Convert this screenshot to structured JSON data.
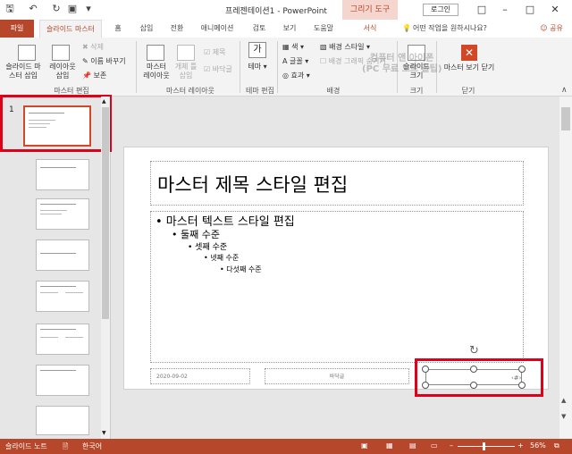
{
  "window": {
    "title": "프레젠테이션1  -  PowerPoint",
    "context_tab": "그리기 도구",
    "login": "로그인"
  },
  "tabs": [
    "파일",
    "슬라이드 마스터",
    "홈",
    "삽입",
    "전환",
    "애니메이션",
    "검토",
    "보기",
    "도움말",
    "서식"
  ],
  "tell_me": "어떤 작업을 원하시나요?",
  "share": "공유",
  "ribbon": {
    "insert_slide_master": "슬라이드 마\n스터 삽입",
    "insert_layout": "레이아웃\n삽입",
    "delete": "삭제",
    "rename": "이름 바꾸기",
    "preserve": "보존",
    "group_edit_master": "마스터 편집",
    "master_layout": "마스터\n레이아웃",
    "insert_placeholder": "개체 틀\n삽입",
    "title_check": "제목",
    "footer_check": "바닥글",
    "group_master_layout": "마스터 레이아웃",
    "themes": "테마",
    "group_edit_theme": "테마 편집",
    "colors": "색",
    "fonts": "글꼴",
    "effects": "효과",
    "background_styles": "배경 스타일",
    "hide_bg": "배경 그래픽 숨기기",
    "group_background": "배경",
    "slide_size": "슬라이드\n크기",
    "group_size": "크기",
    "close_master": "마스터 보기 닫기",
    "group_close": "닫기"
  },
  "watermark": "컴퓨터 앤 아이폰\n(PC 무료 노트 꿀팁)",
  "slide_number": "1",
  "slide": {
    "title": "마스터 제목 스타일 편집",
    "level1": "• 마스터 텍스트 스타일 편집",
    "level2": "• 둘째 수준",
    "level3": "• 셋째 수준",
    "level4": "• 넷째 수준",
    "level5": "• 다섯째 수준",
    "date": "2020-09-02",
    "footer": "바닥글"
  },
  "status": {
    "view": "슬라이드 노트",
    "language": "한국어",
    "zoom": "56%"
  },
  "colors": {
    "accent": "#b7472a",
    "highlight": "#e0001a"
  }
}
